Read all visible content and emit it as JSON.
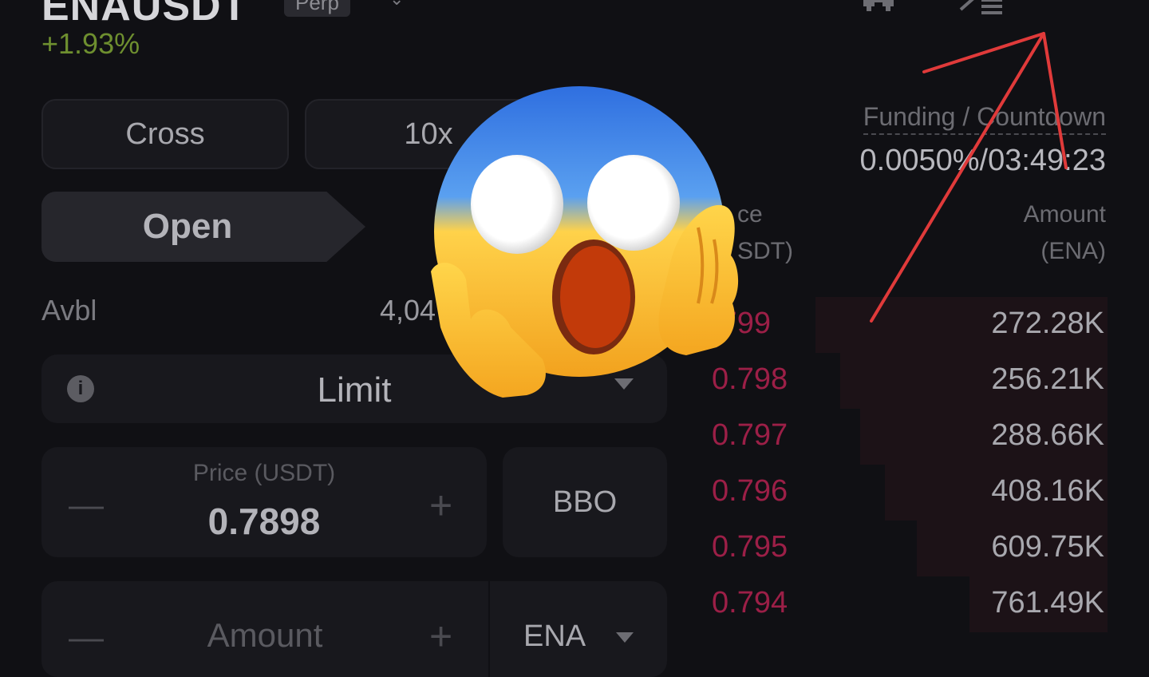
{
  "header": {
    "symbol": "ENAUSDT",
    "contract_tag": "Perp",
    "change_pct": "+1.93%",
    "icons": [
      "candlestick-chart-icon",
      "menu-list-icon"
    ]
  },
  "trade_panel": {
    "margin_mode": "Cross",
    "leverage": "10x",
    "tab_open": "Open",
    "avbl_label": "Avbl",
    "avbl_value": "4,04",
    "order_type": "Limit",
    "price_label": "Price (USDT)",
    "price_value": "0.7898",
    "bbo_label": "BBO",
    "amount_label": "Amount",
    "amount_unit": "ENA"
  },
  "funding": {
    "label": "Funding / Countdown",
    "value": "0.0050%/03:49:23"
  },
  "orderbook": {
    "price_header_line1": "ce",
    "price_header_line2": "SDT)",
    "amount_header_line1": "Amount",
    "amount_header_line2": "(ENA)",
    "asks": [
      {
        "price": ".799",
        "amount": "272.28K",
        "depth": 0.72
      },
      {
        "price": "0.798",
        "amount": "256.21K",
        "depth": 0.66
      },
      {
        "price": "0.797",
        "amount": "288.66K",
        "depth": 0.61
      },
      {
        "price": "0.796",
        "amount": "408.16K",
        "depth": 0.55
      },
      {
        "price": "0.795",
        "amount": "609.75K",
        "depth": 0.47
      },
      {
        "price": "0.794",
        "amount": "761.49K",
        "depth": 0.34
      }
    ]
  },
  "colors": {
    "background": "#101014",
    "ask_red": "#9c1f47",
    "change_green": "#6e8f2f",
    "annotation_red": "#e03a3a"
  }
}
